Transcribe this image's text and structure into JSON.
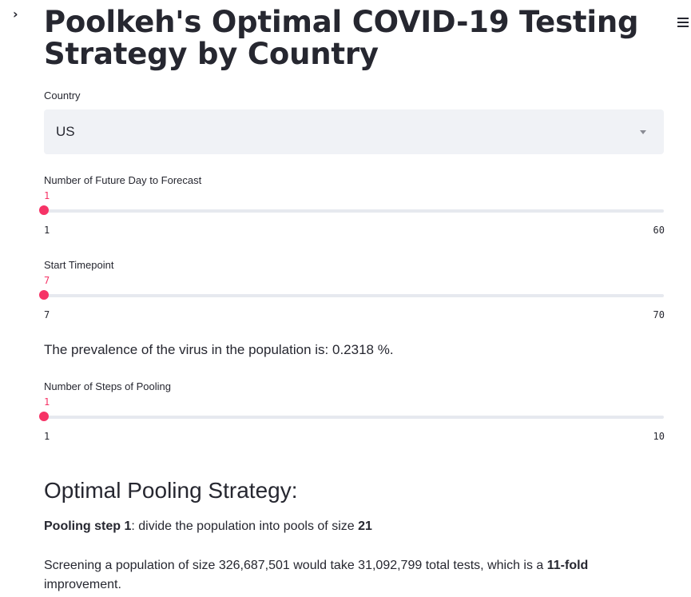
{
  "header": {
    "title": "Poolkeh's Optimal COVID-19 Testing Strategy by Country",
    "sidebar_toggle_icon": "chevron-right-icon",
    "menu_icon": "hamburger-menu-icon"
  },
  "country_select": {
    "label": "Country",
    "value": "US"
  },
  "forecast_slider": {
    "label": "Number of Future Day to Forecast",
    "value": "1",
    "min": "1",
    "max": "60",
    "fraction": 0
  },
  "timepoint_slider": {
    "label": "Start Timepoint",
    "value": "7",
    "min": "7",
    "max": "70",
    "fraction": 0
  },
  "prevalence": {
    "text": "The prevalence of the virus in the population is: 0.2318 %."
  },
  "pooling_slider": {
    "label": "Number of Steps of Pooling",
    "value": "1",
    "min": "1",
    "max": "10",
    "fraction": 0
  },
  "result": {
    "heading": "Optimal Pooling Strategy:",
    "step_label": "Pooling step 1",
    "step_text": ": divide the population into pools of size ",
    "pool_size": "21",
    "screening_text": "Screening a population of size 326,687,501 would take 31,092,799 total tests, which is a ",
    "fold": "11-fold",
    "screening_end": " improvement."
  },
  "colors": {
    "accent": "#f63366",
    "text": "#262730",
    "select_bg": "#f0f2f6",
    "track": "#e6e9ef"
  }
}
